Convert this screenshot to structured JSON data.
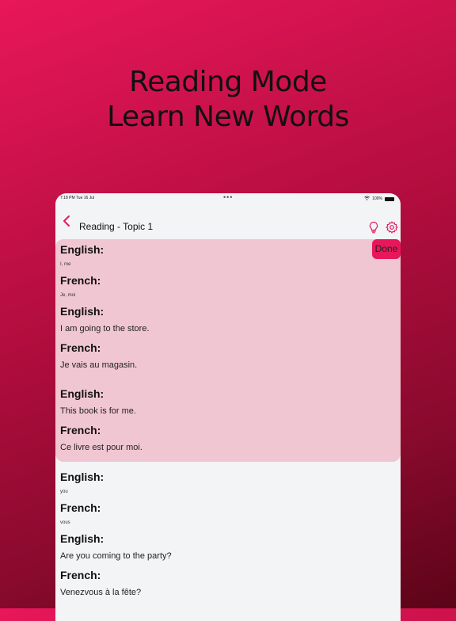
{
  "promo": {
    "line1": "Reading Mode",
    "line2": "Learn New Words"
  },
  "status": {
    "time": "7:18 PM   Tue 16 Jul",
    "dots": "•••",
    "battery": "100%"
  },
  "nav": {
    "title": "Reading - Topic 1"
  },
  "done_label": "Done",
  "entries": [
    {
      "label": "English:",
      "value": "I, me"
    },
    {
      "label": "French:",
      "value": "Je, moi"
    },
    {
      "label": "English:",
      "value": "I am going to the store."
    },
    {
      "label": "French:",
      "value": "Je vais au magasin."
    },
    {
      "label": "English:",
      "value": "This book is for me."
    },
    {
      "label": "French:",
      "value": "Ce livre est pour moi."
    },
    {
      "label": "English:",
      "value": "you"
    },
    {
      "label": "French:",
      "value": "vous"
    },
    {
      "label": "English:",
      "value": "Are you coming to the party?"
    },
    {
      "label": "French:",
      "value": "Venezvous à la fête?"
    }
  ],
  "colors": {
    "accent": "#e8175a",
    "highlight": "#f1c6d3",
    "background": "#c31246"
  }
}
